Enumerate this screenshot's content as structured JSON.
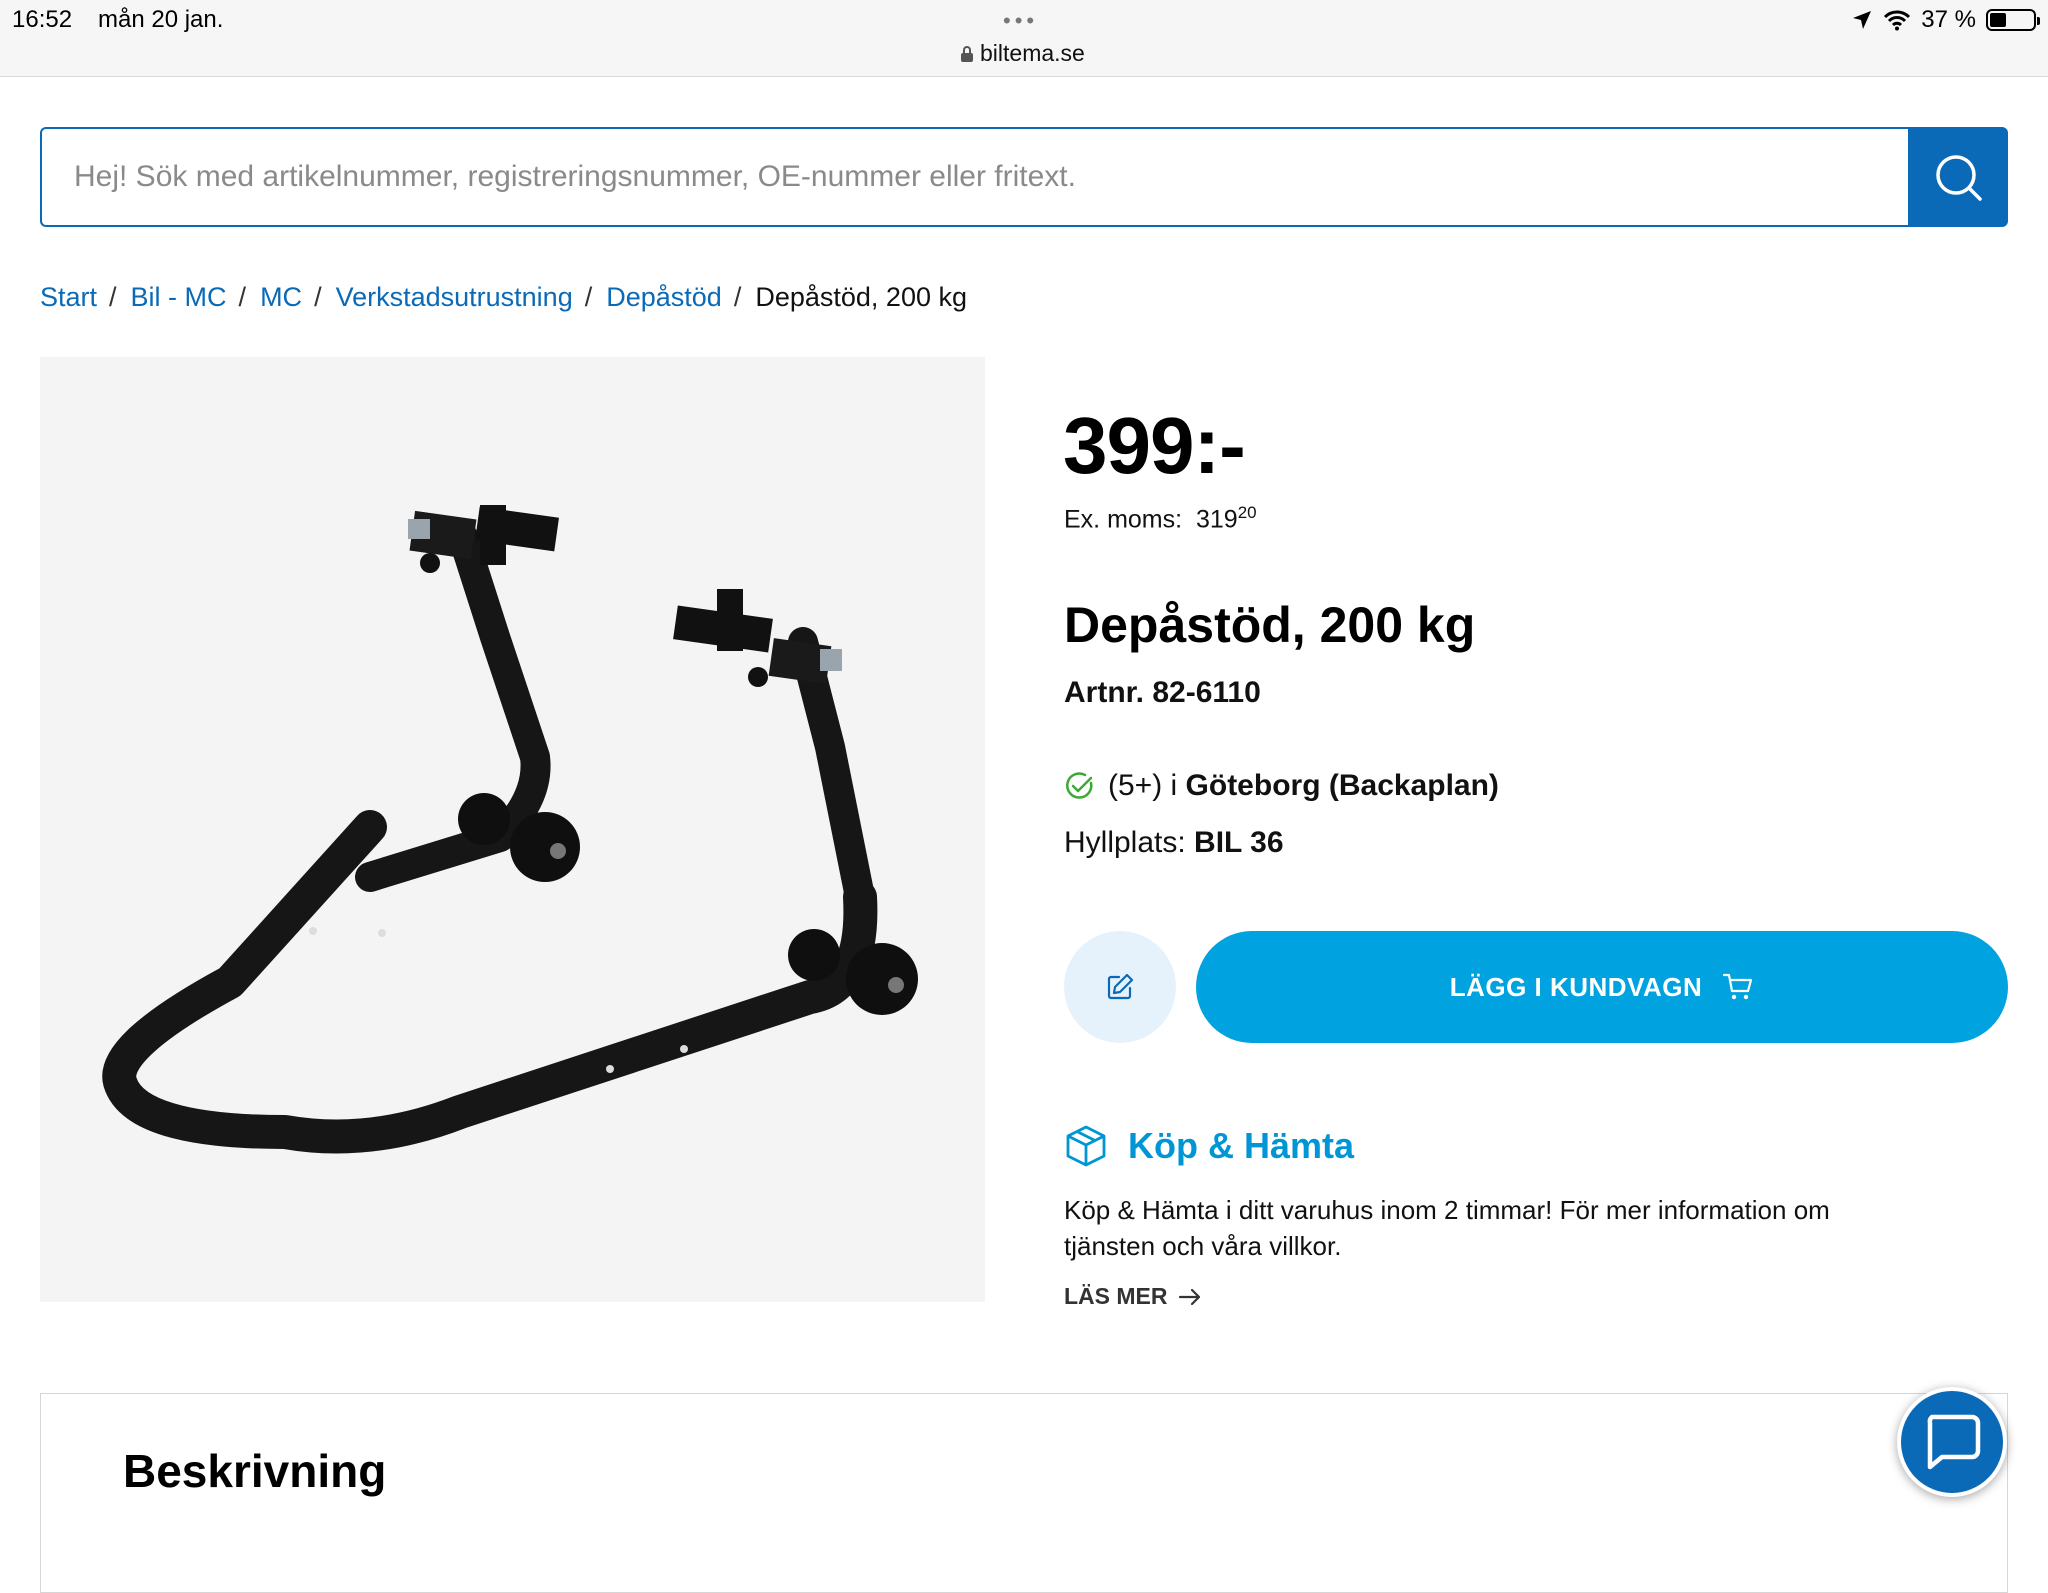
{
  "status_bar": {
    "time": "16:52",
    "date": "mån 20 jan.",
    "dots": "•••",
    "url": "biltema.se",
    "battery": "37 %",
    "battery_level": 0.37
  },
  "search": {
    "placeholder": "Hej! Sök med artikelnummer, registreringsnummer, OE-nummer eller fritext."
  },
  "breadcrumb": {
    "items": [
      "Start",
      "Bil - MC",
      "MC",
      "Verkstadsutrustning",
      "Depåstöd"
    ],
    "separator": "/",
    "current": "Depåstöd, 200 kg"
  },
  "product": {
    "price": "399:-",
    "ex_moms_label": "Ex. moms:",
    "ex_moms_whole": "319",
    "ex_moms_fraction": "20",
    "title": "Depåstöd, 200 kg",
    "artnr": "Artnr. 82-6110",
    "stock_count": "(5+) i",
    "stock_store": "Göteborg (Backaplan)",
    "shelf_label": "Hyllplats:",
    "shelf_value": "BIL 36",
    "add_to_cart_label": "LÄGG I KUNDVAGN"
  },
  "kop_hamta": {
    "title": "Köp & Hämta",
    "text": "Köp & Hämta i ditt varuhus inom 2 timmar! För mer information om tjänsten och våra villkor.",
    "read_more": "LÄS MER"
  },
  "description": {
    "title": "Beskrivning"
  },
  "colors": {
    "brand_blue": "#0a6ab7",
    "cart_button": "#00a3e0",
    "stock_green": "#3aaa35",
    "kop_hamta_blue": "#0096d6"
  },
  "icons": [
    "location-arrow-icon",
    "wifi-icon",
    "battery-icon",
    "lock-icon",
    "search-icon",
    "check-circle-icon",
    "edit-icon",
    "cart-icon",
    "box-icon",
    "arrow-right-icon",
    "chat-icon"
  ]
}
